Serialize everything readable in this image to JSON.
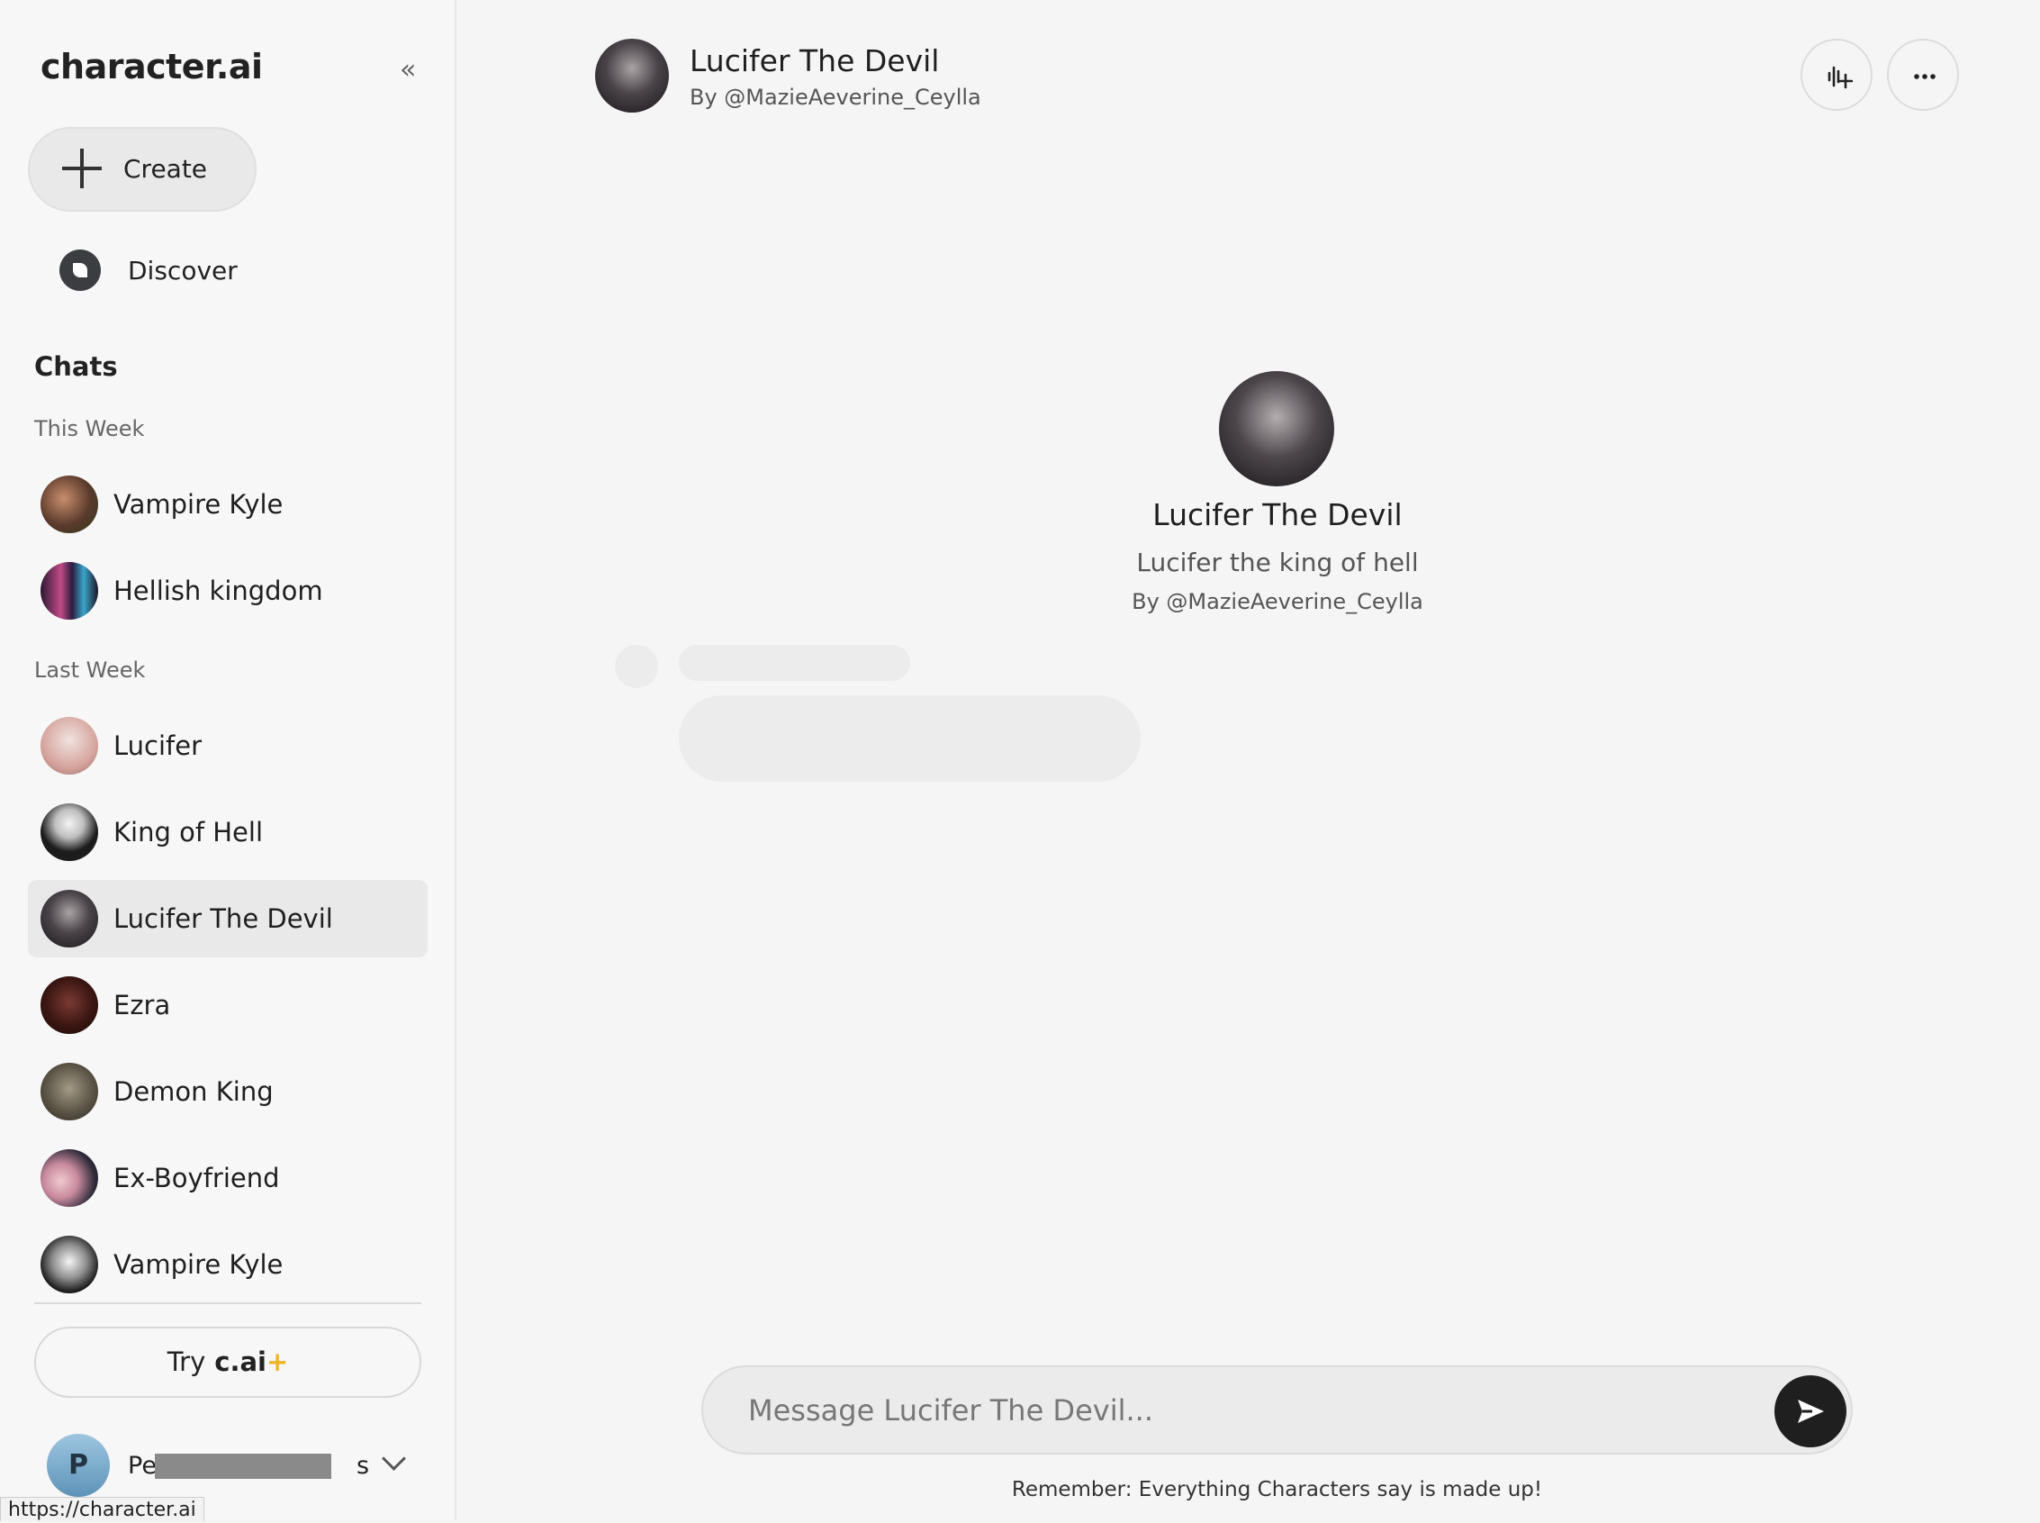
{
  "sidebar": {
    "logo": "character.ai",
    "collapse_icon": "«",
    "create_label": "Create",
    "discover_label": "Discover",
    "chats_title": "Chats",
    "groups": {
      "this_week": "This Week",
      "last_week": "Last Week"
    },
    "this_week_items": [
      {
        "name": "Vampire Kyle"
      },
      {
        "name": "Hellish kingdom"
      }
    ],
    "last_week_items": [
      {
        "name": "Lucifer"
      },
      {
        "name": "King of Hell"
      },
      {
        "name": "Lucifer The Devil",
        "active": true
      },
      {
        "name": "Ezra"
      },
      {
        "name": "Demon King"
      },
      {
        "name": "Ex-Boyfriend"
      },
      {
        "name": "Vampire Kyle"
      }
    ],
    "try_label": "Try",
    "try_brand": "c.ai",
    "try_spark": "+",
    "user": {
      "initial": "P",
      "name_prefix": "Pe",
      "name_suffix": "s"
    },
    "url_tooltip": "https://character.ai"
  },
  "header": {
    "name": "Lucifer The Devil",
    "by": "By @MazieAeverine_Ceylla"
  },
  "profile": {
    "name": "Lucifer The Devil",
    "tagline": "Lucifer the king of hell",
    "by": "By @MazieAeverine_Ceylla"
  },
  "composer": {
    "placeholder": "Message Lucifer The Devil...",
    "disclaimer": "Remember: Everything Characters say is made up!"
  },
  "icons": [
    "chevrons-left-icon",
    "plus-icon",
    "compass-icon",
    "voice-add-icon",
    "more-icon",
    "send-icon",
    "chevron-down-icon"
  ]
}
